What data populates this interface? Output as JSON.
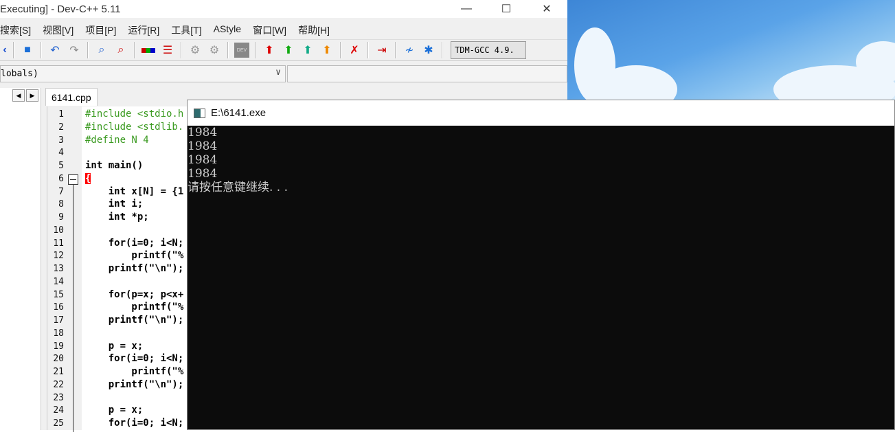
{
  "ide": {
    "title": "Executing] - Dev-C++ 5.11",
    "window_buttons": {
      "minimize": "—",
      "maximize": "☐",
      "close": "✕"
    },
    "menu": [
      "搜索[S]",
      "视图[V]",
      "项目[P]",
      "运行[R]",
      "工具[T]",
      "AStyle",
      "窗口[W]",
      "帮助[H]"
    ],
    "compiler": "TDM-GCC 4.9.",
    "scope_combo": "lobals)",
    "tab": "6141.cpp",
    "code": [
      {
        "n": "1",
        "t": "#include <stdio.h",
        "pp": true
      },
      {
        "n": "2",
        "t": "#include <stdlib.",
        "pp": true
      },
      {
        "n": "3",
        "t": "#define N 4",
        "pp": true
      },
      {
        "n": "4",
        "t": ""
      },
      {
        "n": "5",
        "t": "int main()"
      },
      {
        "n": "6",
        "t": "{"
      },
      {
        "n": "7",
        "t": "    int x[N] = {1"
      },
      {
        "n": "8",
        "t": "    int i;"
      },
      {
        "n": "9",
        "t": "    int *p;"
      },
      {
        "n": "10",
        "t": ""
      },
      {
        "n": "11",
        "t": "    for(i=0; i<N;"
      },
      {
        "n": "12",
        "t": "        printf(\"%"
      },
      {
        "n": "13",
        "t": "    printf(\"\\n\");"
      },
      {
        "n": "14",
        "t": ""
      },
      {
        "n": "15",
        "t": "    for(p=x; p<x+"
      },
      {
        "n": "16",
        "t": "        printf(\"%"
      },
      {
        "n": "17",
        "t": "    printf(\"\\n\");"
      },
      {
        "n": "18",
        "t": ""
      },
      {
        "n": "19",
        "t": "    p = x;"
      },
      {
        "n": "20",
        "t": "    for(i=0; i<N;"
      },
      {
        "n": "21",
        "t": "        printf(\"%"
      },
      {
        "n": "22",
        "t": "    printf(\"\\n\");"
      },
      {
        "n": "23",
        "t": ""
      },
      {
        "n": "24",
        "t": "    p = x;"
      },
      {
        "n": "25",
        "t": "    for(i=0; i<N;"
      }
    ]
  },
  "console": {
    "title": "E:\\6141.exe",
    "output": [
      "1984",
      "1984",
      "1984",
      "1984",
      "请按任意键继续. . ."
    ]
  }
}
